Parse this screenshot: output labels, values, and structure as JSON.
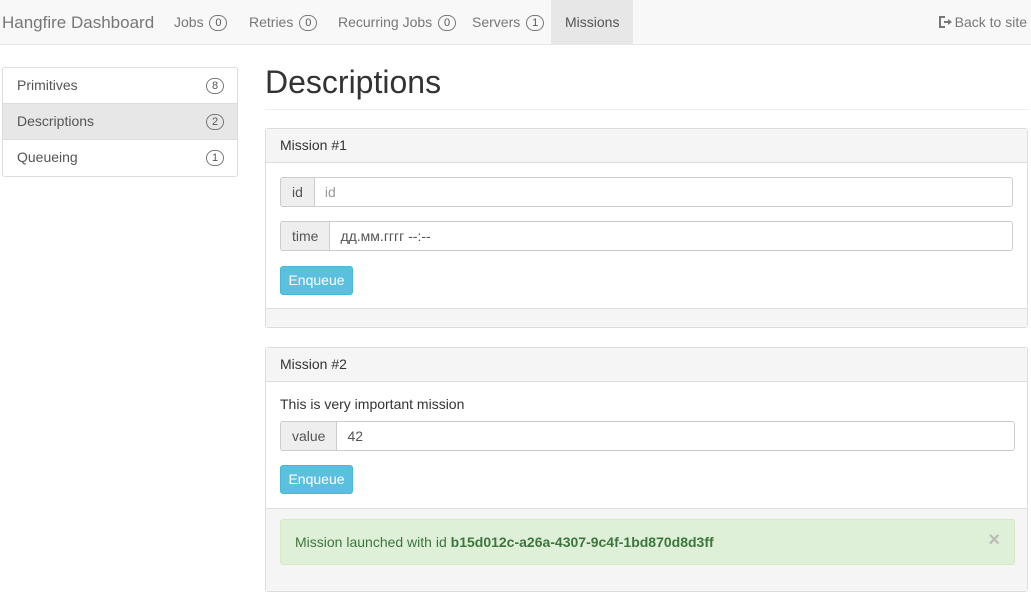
{
  "navbar": {
    "brand": "Hangfire Dashboard",
    "items": [
      {
        "label": "Jobs",
        "count": "0"
      },
      {
        "label": "Retries",
        "count": "0"
      },
      {
        "label": "Recurring Jobs",
        "count": "0"
      },
      {
        "label": "Servers",
        "count": "1"
      },
      {
        "label": "Missions"
      }
    ],
    "back_link": "Back to site"
  },
  "sidebar": {
    "items": [
      {
        "label": "Primitives",
        "count": "8"
      },
      {
        "label": "Descriptions",
        "count": "2"
      },
      {
        "label": "Queueing",
        "count": "1"
      }
    ]
  },
  "main": {
    "title": "Descriptions",
    "missions": [
      {
        "heading": "Mission #1",
        "fields": [
          {
            "label": "id",
            "placeholder": "id",
            "value": ""
          },
          {
            "label": "time",
            "value": "дд.мм.гггг --:--"
          }
        ],
        "button": "Enqueue"
      },
      {
        "heading": "Mission #2",
        "description": "This is very important mission",
        "fields": [
          {
            "label": "value",
            "value": "42"
          }
        ],
        "button": "Enqueue",
        "alert": {
          "prefix": "Mission launched with id",
          "id": "b15d012c-a26a-4307-9c4f-1bd870d8d3ff",
          "close": "×"
        }
      }
    ]
  },
  "colors": {
    "accent_button": "#5bc0de",
    "success_bg": "#dff0d8",
    "success_text": "#3c763d"
  }
}
